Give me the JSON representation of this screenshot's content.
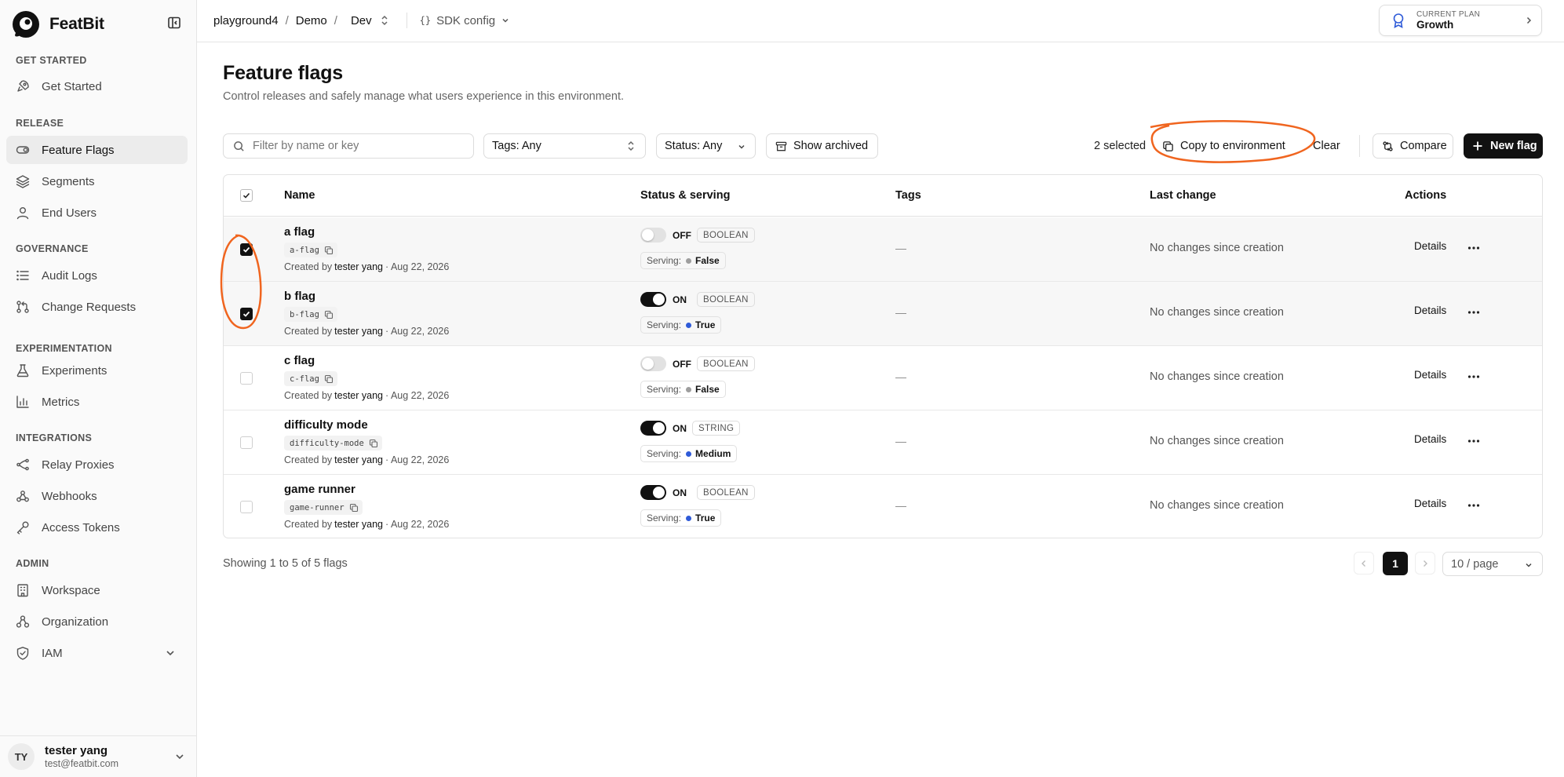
{
  "app": {
    "name": "FeatBit"
  },
  "sidebar": {
    "groups": [
      {
        "title": "GET STARTED",
        "items": [
          {
            "label": "Get Started",
            "icon": "rocket-icon"
          }
        ]
      },
      {
        "title": "RELEASE",
        "items": [
          {
            "label": "Feature Flags",
            "icon": "toggle-icon",
            "active": true
          },
          {
            "label": "Segments",
            "icon": "layers-icon"
          },
          {
            "label": "End Users",
            "icon": "user-icon"
          }
        ]
      },
      {
        "title": "GOVERNANCE",
        "items": [
          {
            "label": "Audit Logs",
            "icon": "list-icon"
          },
          {
            "label": "Change Requests",
            "icon": "git-pull-request-icon"
          }
        ]
      },
      {
        "title": "EXPERIMENTATION",
        "items": [
          {
            "label": "Experiments",
            "icon": "flask-icon"
          },
          {
            "label": "Metrics",
            "icon": "bar-chart-icon"
          }
        ]
      },
      {
        "title": "INTEGRATIONS",
        "items": [
          {
            "label": "Relay Proxies",
            "icon": "relay-icon"
          },
          {
            "label": "Webhooks",
            "icon": "webhook-icon"
          },
          {
            "label": "Access Tokens",
            "icon": "key-icon"
          }
        ]
      },
      {
        "title": "ADMIN",
        "items": [
          {
            "label": "Workspace",
            "icon": "building-icon"
          },
          {
            "label": "Organization",
            "icon": "org-icon"
          },
          {
            "label": "IAM",
            "icon": "shield-icon"
          }
        ]
      }
    ],
    "user": {
      "initials": "TY",
      "name": "tester yang",
      "email": "test@featbit.com"
    }
  },
  "topbar": {
    "breadcrumbs": {
      "project": "playground4",
      "env_group": "Demo",
      "env": "Dev"
    },
    "sdk_config": "SDK config",
    "plan": {
      "label": "CURRENT PLAN",
      "value": "Growth"
    }
  },
  "page": {
    "title": "Feature flags",
    "subtitle": "Control releases and safely manage what users experience in this environment."
  },
  "toolbar": {
    "search_placeholder": "Filter by name or key",
    "tags_filter": "Tags: Any",
    "status_filter": "Status: Any",
    "show_archived": "Show archived",
    "selected_count": "2 selected",
    "copy_to_env": "Copy to environment",
    "clear": "Clear",
    "compare": "Compare",
    "new_flag": "New flag"
  },
  "table": {
    "columns": {
      "name": "Name",
      "status": "Status & serving",
      "tags": "Tags",
      "last_change": "Last change",
      "actions": "Actions"
    },
    "rows": [
      {
        "name": "a flag",
        "key": "a-flag",
        "created_by": "tester yang",
        "created_at": "· Aug 22, 2026",
        "selected": true,
        "state": "OFF",
        "on": false,
        "type": "BOOLEAN",
        "serving_label": "Serving:",
        "serving": "False",
        "serving_color": "#9e9e9e",
        "tags": "—",
        "last_change": "No changes since creation",
        "details": "Details"
      },
      {
        "name": "b flag",
        "key": "b-flag",
        "created_by": "tester yang",
        "created_at": "· Aug 22, 2026",
        "selected": true,
        "state": "ON",
        "on": true,
        "type": "BOOLEAN",
        "serving_label": "Serving:",
        "serving": "True",
        "serving_color": "#2f5bd8",
        "tags": "—",
        "last_change": "No changes since creation",
        "details": "Details"
      },
      {
        "name": "c flag",
        "key": "c-flag",
        "created_by": "tester yang",
        "created_at": "· Aug 22, 2026",
        "selected": false,
        "state": "OFF",
        "on": false,
        "type": "BOOLEAN",
        "serving_label": "Serving:",
        "serving": "False",
        "serving_color": "#9e9e9e",
        "tags": "—",
        "last_change": "No changes since creation",
        "details": "Details"
      },
      {
        "name": "difficulty mode",
        "key": "difficulty-mode",
        "created_by": "tester yang",
        "created_at": "· Aug 22, 2026",
        "selected": false,
        "state": "ON",
        "on": true,
        "type": "STRING",
        "serving_label": "Serving:",
        "serving": "Medium",
        "serving_color": "#2f5bd8",
        "tags": "—",
        "last_change": "No changes since creation",
        "details": "Details"
      },
      {
        "name": "game runner",
        "key": "game-runner",
        "created_by": "tester yang",
        "created_at": "· Aug 22, 2026",
        "selected": false,
        "state": "ON",
        "on": true,
        "type": "BOOLEAN",
        "serving_label": "Serving:",
        "serving": "True",
        "serving_color": "#2f5bd8",
        "tags": "—",
        "last_change": "No changes since creation",
        "details": "Details"
      }
    ],
    "created_by_prefix": "Created by"
  },
  "pagination": {
    "summary": "Showing 1 to 5 of 5 flags",
    "current_page": "1",
    "page_size": "10 / page"
  },
  "colors": {
    "accent": "#111111",
    "annotation": "#f0651f",
    "serving_on": "#2f5bd8",
    "serving_off": "#9e9e9e"
  }
}
